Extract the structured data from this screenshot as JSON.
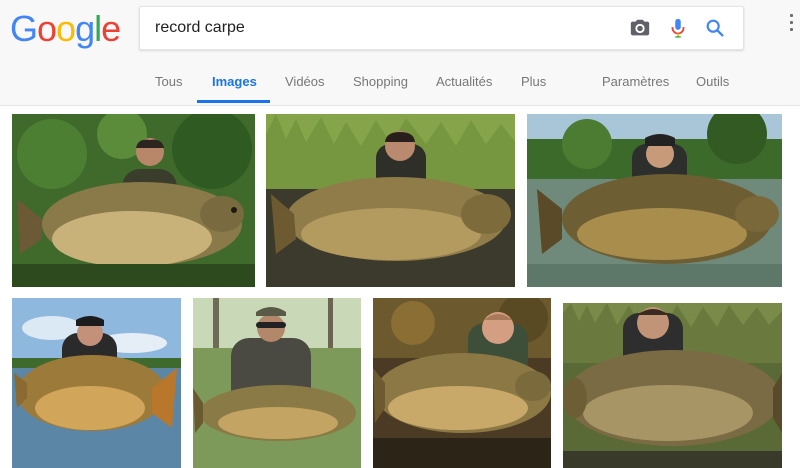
{
  "logo": {
    "letters": [
      "G",
      "o",
      "o",
      "g",
      "l",
      "e"
    ],
    "colors": [
      "#4285F4",
      "#EA4335",
      "#FBBC05",
      "#4285F4",
      "#34A853",
      "#EA4335"
    ]
  },
  "search": {
    "query": "record carpe"
  },
  "icons": {
    "camera": "camera-icon",
    "microphone": "microphone-icon",
    "search": "search-icon",
    "apps": "more-vert-icon"
  },
  "tabs": [
    {
      "label": "Tous"
    },
    {
      "label": "Images",
      "active": true
    },
    {
      "label": "Vidéos"
    },
    {
      "label": "Shopping"
    },
    {
      "label": "Actualités"
    },
    {
      "label": "Plus"
    },
    {
      "label": "Paramètres"
    },
    {
      "label": "Outils"
    }
  ],
  "colors": {
    "accent": "#1a73e8",
    "tab_text": "#777777",
    "header_bg": "#f8f8f8"
  },
  "images": [
    {
      "subject": "man holding giant mirror carp, green foliage background"
    },
    {
      "subject": "man holding giant mirror carp in water, reeds behind"
    },
    {
      "subject": "man in cap holding giant mirror carp in lake"
    },
    {
      "subject": "man in cap holding carp, lake and sky background"
    },
    {
      "subject": "man in cap and sunglasses holding carp by trees"
    },
    {
      "subject": "smiling man holding large common carp"
    },
    {
      "subject": "man holding large mirror carp, reeds behind"
    }
  ]
}
